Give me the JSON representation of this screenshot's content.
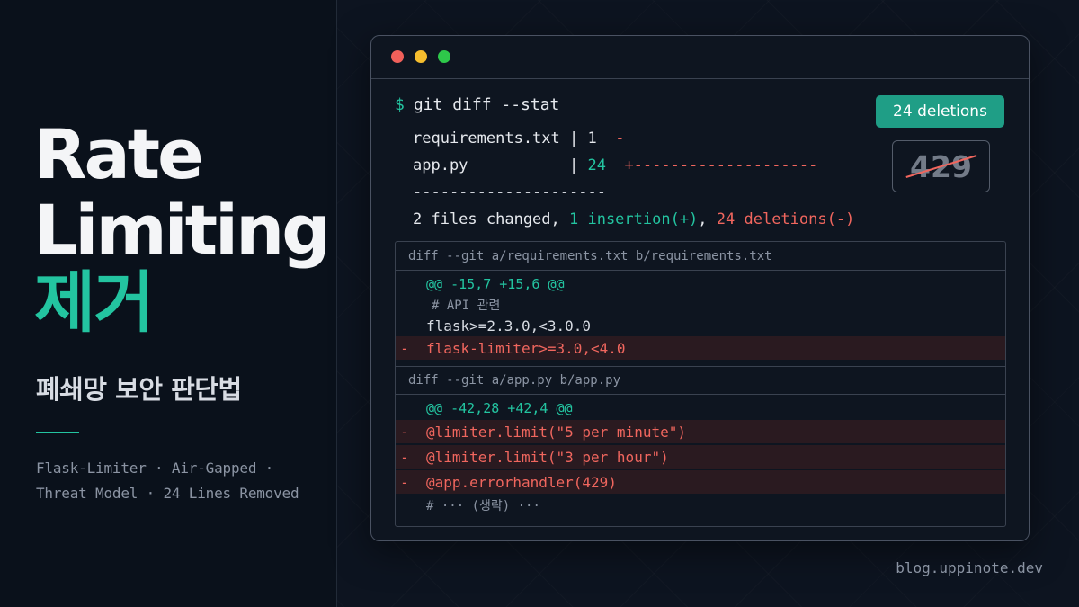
{
  "left": {
    "title_line1": "Rate",
    "title_line2": "Limiting",
    "title_ko": "제거",
    "subtitle": "폐쇄망 보안 판단법",
    "tags_line1": "Flask-Limiter · Air-Gapped ·",
    "tags_line2": "Threat Model · 24 Lines Removed"
  },
  "terminal": {
    "prompt": "$",
    "command": "git diff --stat",
    "stat_lines": [
      {
        "file": "requirements.txt | ",
        "count": "1",
        "bar": "-"
      },
      {
        "file": "app.py           | ",
        "count": "24",
        "bar": "+--------------------"
      }
    ],
    "separator": "---------------------",
    "summary_prefix": "2 files changed, ",
    "summary_ins": "1 insertion(+)",
    "summary_sep": ", ",
    "summary_del": "24 deletions(-)",
    "badge": "24 deletions",
    "status_code": "429"
  },
  "diff": {
    "file1_header": "diff --git a/requirements.txt b/requirements.txt",
    "file1_hunk": "@@ -15,7 +15,6 @@",
    "file1_lines": [
      {
        "sign": "",
        "text": "# API 관련"
      },
      {
        "sign": "",
        "text": "flask>=2.3.0,<3.0.0"
      },
      {
        "sign": "-",
        "text": "flask-limiter>=3.0,<4.0"
      }
    ],
    "file2_header": "diff --git a/app.py b/app.py",
    "file2_hunk": "@@ -42,28 +42,4 @@",
    "file2_lines": [
      {
        "sign": "-",
        "text": "@limiter.limit(\"5 per minute\")"
      },
      {
        "sign": "-",
        "text": "@limiter.limit(\"3 per hour\")"
      },
      {
        "sign": "-",
        "text": "@app.errorhandler(429)"
      },
      {
        "sign": "",
        "text": "# ··· (생략) ···"
      }
    ]
  },
  "footer": "blog.uppinote.dev",
  "colors": {
    "accent": "#23c4a0",
    "deletion": "#f0665e",
    "background": "#0d1420"
  }
}
